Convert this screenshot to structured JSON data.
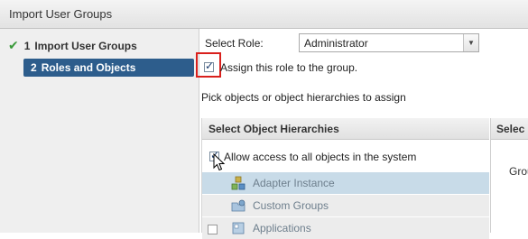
{
  "window": {
    "title": "Import User Groups"
  },
  "wizard": {
    "steps": [
      {
        "number": "1",
        "label": "Import User Groups",
        "status": "completed",
        "icon": "checkmark-icon"
      },
      {
        "number": "2",
        "label": "Roles and Objects",
        "status": "active"
      }
    ]
  },
  "role": {
    "label": "Select Role:",
    "selected": "Administrator",
    "assign_label": "Assign this role to the group.",
    "assign_checked": true
  },
  "pick_label": "Pick objects or object hierarchies to assign",
  "hierarchies": {
    "title": "Select Object Hierarchies",
    "allow_all_label": "Allow access to all objects in the system",
    "allow_all_checked": true,
    "items": [
      {
        "label": "Adapter Instance",
        "icon": "adapter-icon"
      },
      {
        "label": "Custom Groups",
        "icon": "custom-groups-icon"
      },
      {
        "label": "Applications",
        "icon": "applications-icon"
      }
    ]
  },
  "right_panel": {
    "title": "Selec",
    "text": "Grou"
  },
  "colors": {
    "active_step": "#2d5d8c",
    "highlight": "#d9201c",
    "selected_row": "#c8dbe8",
    "check_green": "#3a9a3a"
  }
}
